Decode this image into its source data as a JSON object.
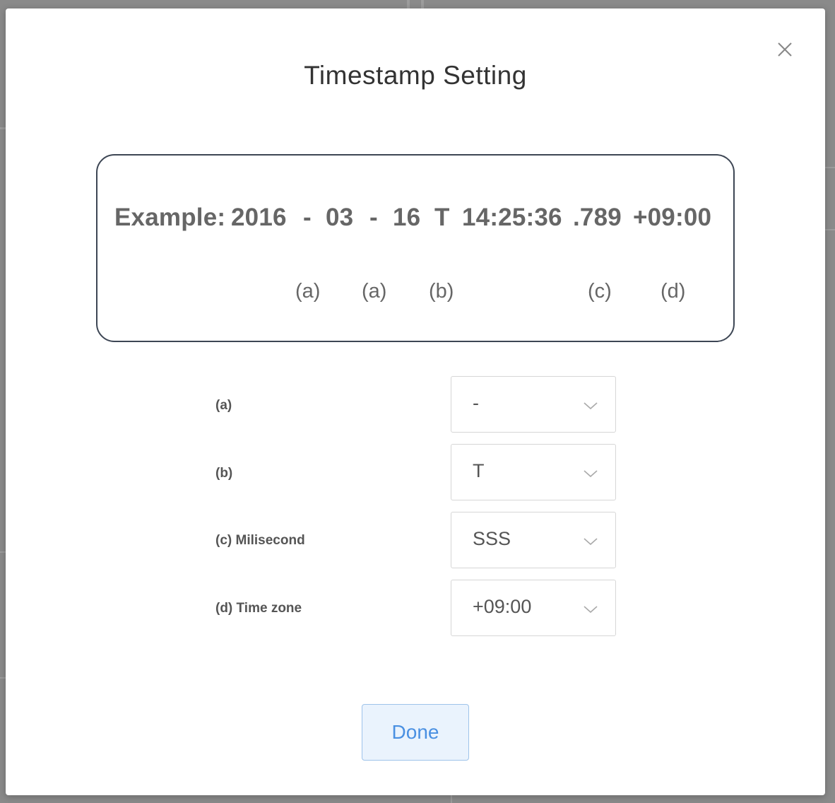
{
  "modal": {
    "title": "Timestamp Setting"
  },
  "example": {
    "label": "Example:",
    "year": "2016",
    "sep1": "-",
    "month": "03",
    "sep2": "-",
    "day": "16",
    "t_sep": "T",
    "time": "14:25:36",
    "millis": ".789",
    "zone": "+09:00",
    "markers": {
      "a1": "(a)",
      "a2": "(a)",
      "b": "(b)",
      "c": "(c)",
      "d": "(d)"
    }
  },
  "fields": [
    {
      "label": "(a)",
      "value": "-"
    },
    {
      "label": "(b)",
      "value": "T"
    },
    {
      "label": "(c) Milisecond",
      "value": "SSS"
    },
    {
      "label": "(d) Time zone",
      "value": "+09:00"
    }
  ],
  "done_label": "Done",
  "icons": {
    "close": "close-icon",
    "chevron": "chevron-down-icon"
  },
  "colors": {
    "accent": "#4a90e2",
    "button_bg": "#eaf3fd",
    "box_border": "#3d4654"
  }
}
